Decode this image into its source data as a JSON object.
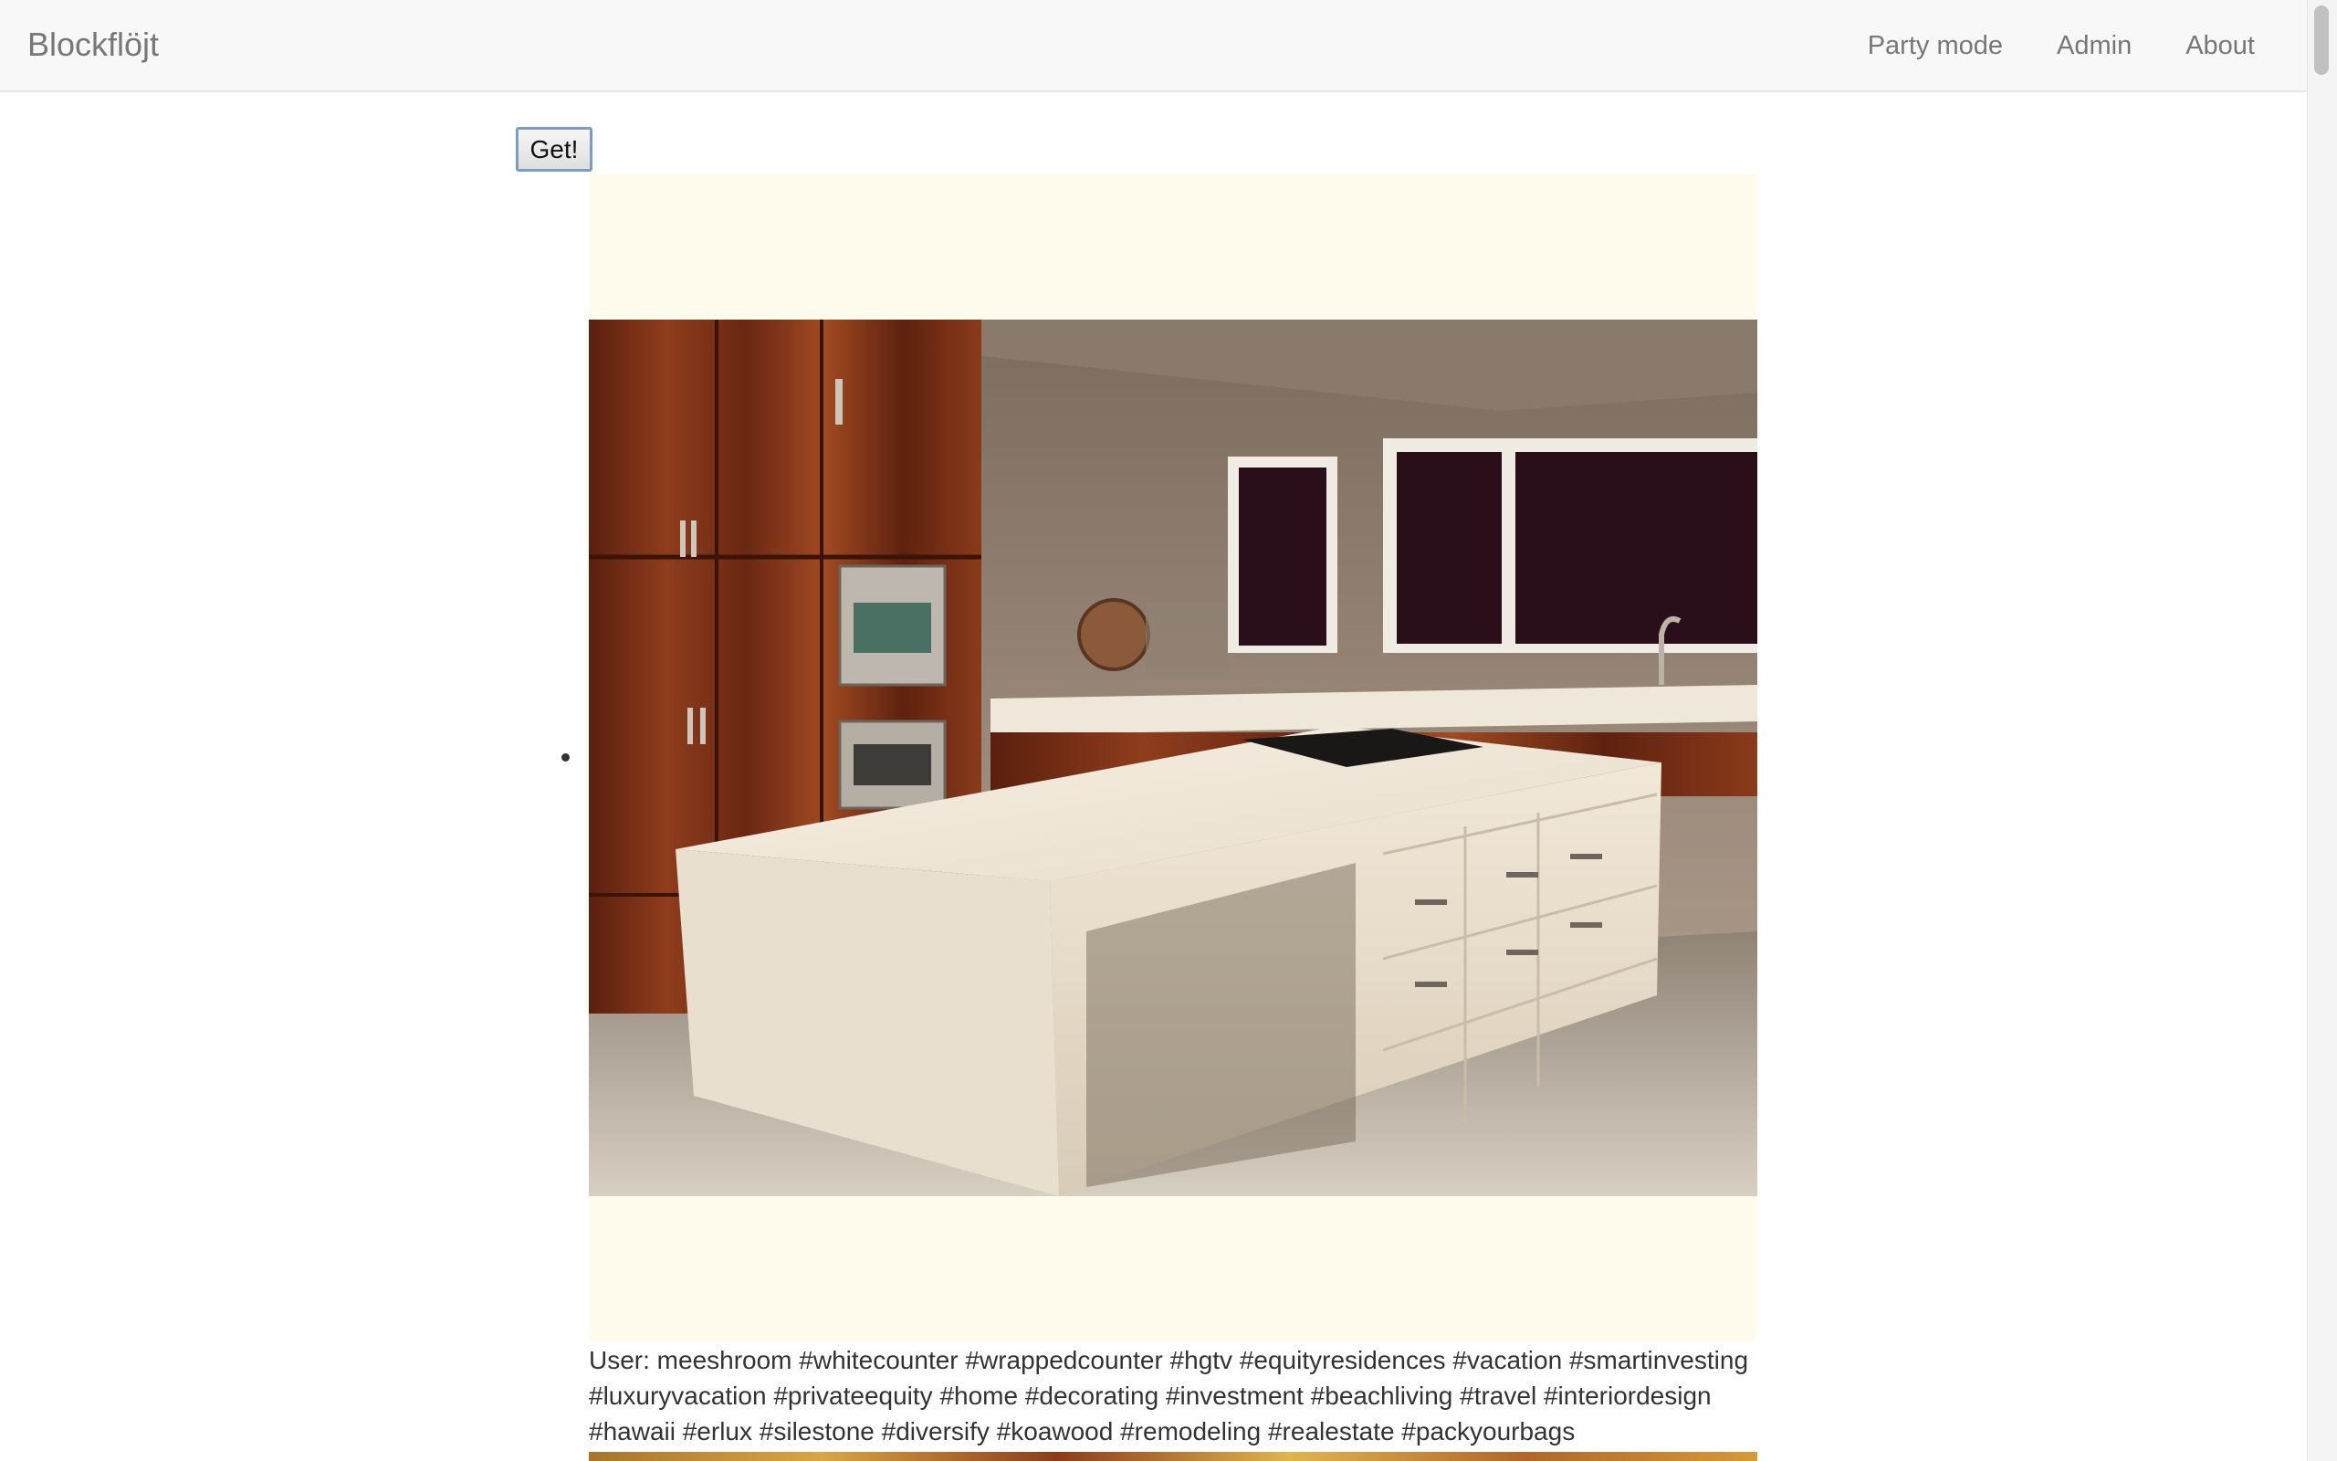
{
  "navbar": {
    "brand": "Blockflöjt",
    "links": [
      {
        "label": "Party mode"
      },
      {
        "label": "Admin"
      },
      {
        "label": "About"
      }
    ]
  },
  "controls": {
    "get_label": "Get!"
  },
  "feed": {
    "items": [
      {
        "image_icon": "kitchen-photo",
        "caption": "User: meeshroom #whitecounter #wrappedcounter #hgtv #equityresidences #vacation #smartinvesting #luxuryvacation #privateequity #home #decorating #investment #beachliving #travel #interiordesign #hawaii #erlux #silestone #diversify #koawood #remodeling #realestate #packyourbags"
      }
    ]
  },
  "colors": {
    "navbar_bg": "#f8f8f8",
    "photo_padding_bg": "#fffbed",
    "text": "#333333",
    "nav_text": "#777777"
  }
}
